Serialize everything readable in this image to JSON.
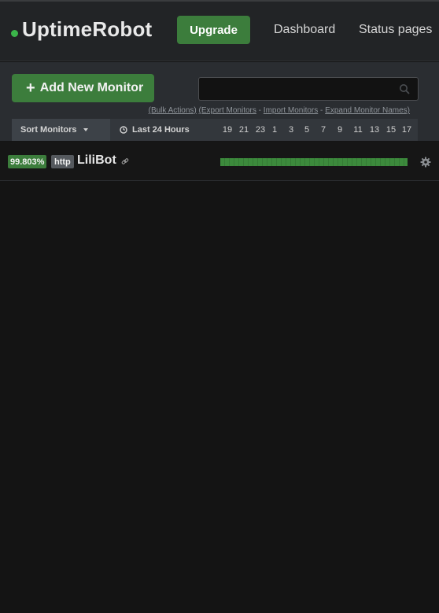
{
  "app": {
    "name": "UptimeRobot",
    "accent": "#3c7d3c"
  },
  "nav": {
    "upgrade_label": "Upgrade",
    "dashboard_label": "Dashboard",
    "status_pages_label": "Status pages"
  },
  "controls": {
    "add_monitor_label": "Add New Monitor",
    "search": {
      "value": "",
      "placeholder": ""
    },
    "bulk_actions": "(Bulk Actions)",
    "export_monitors": "(Export Monitors",
    "import_monitors": "Import Monitors",
    "expand_names": "Expand Monitor Names)",
    "separator": "-"
  },
  "table_header": {
    "sort_label": "Sort Monitors",
    "period_label": "Last 24 Hours",
    "hours": [
      "19",
      "21",
      "23",
      "1",
      "3",
      "5",
      "7",
      "9",
      "11",
      "13",
      "15",
      "17"
    ]
  },
  "monitors": [
    {
      "uptime": "99.803%",
      "type": "http",
      "name": "LiliBot",
      "status_color": "#3c8a3c"
    }
  ],
  "icons": {
    "logo_dot": "status-dot-icon",
    "search": "search-icon",
    "clock": "clock-icon",
    "link": "link-icon",
    "settings": "gear-icon"
  }
}
